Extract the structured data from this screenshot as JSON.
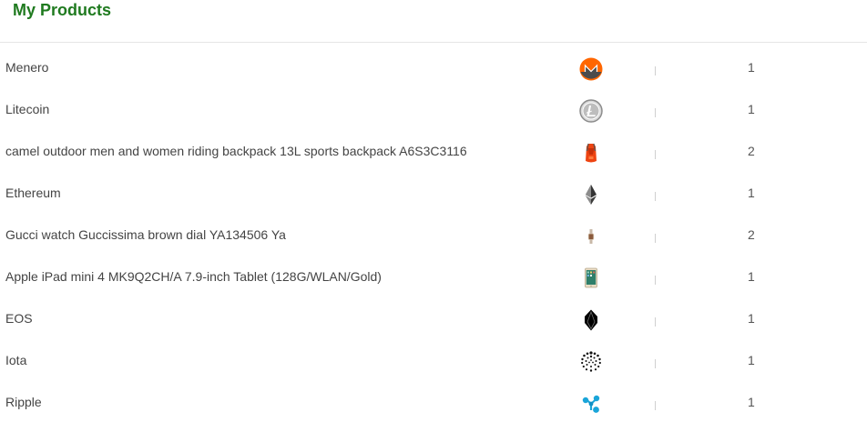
{
  "page": {
    "title": "My Products",
    "title_color": "#1f7a1f"
  },
  "products": [
    {
      "name": "Menero",
      "icon": "monero-coin-icon",
      "quantity": "1"
    },
    {
      "name": "Litecoin",
      "icon": "litecoin-coin-icon",
      "quantity": "1"
    },
    {
      "name": "camel outdoor men and women riding backpack 13L sports backpack A6S3C3116",
      "icon": "backpack-icon",
      "quantity": "2"
    },
    {
      "name": "Ethereum",
      "icon": "ethereum-icon",
      "quantity": "1"
    },
    {
      "name": "Gucci watch Guccissima brown dial YA134506 Ya",
      "icon": "watch-icon",
      "quantity": "2"
    },
    {
      "name": "Apple iPad mini 4 MK9Q2CH/A 7.9-inch Tablet (128G/WLAN/Gold)",
      "icon": "tablet-icon",
      "quantity": "1"
    },
    {
      "name": "EOS",
      "icon": "eos-icon",
      "quantity": "1"
    },
    {
      "name": "Iota",
      "icon": "iota-icon",
      "quantity": "1"
    },
    {
      "name": "Ripple",
      "icon": "ripple-icon",
      "quantity": "1"
    }
  ]
}
